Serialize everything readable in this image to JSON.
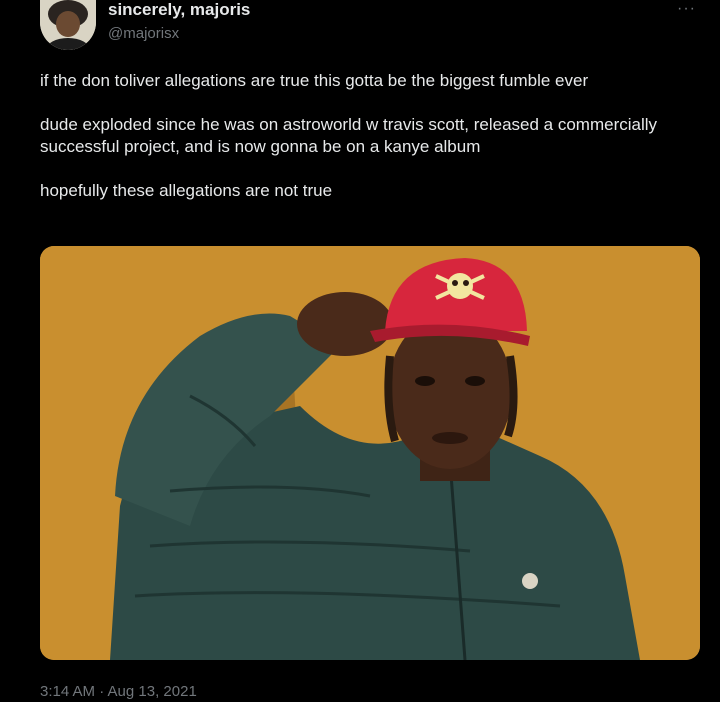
{
  "author": {
    "display_name": "sincerely, majoris",
    "handle": "@majorisx",
    "avatar_icon": "cartoon-avatar-icon"
  },
  "menu": {
    "more_label": "···"
  },
  "tweet": {
    "paragraphs": [
      "if the don toliver allegations are true this gotta be the biggest fumble ever",
      "dude exploded since he was on astroworld w travis scott, released a commercially successful project, and is now gonna be on a kanye album",
      "hopefully these allegations are not true"
    ],
    "timestamp": "3:14 AM · Aug 13, 2021"
  },
  "media": {
    "description_icon": "photo-person-red-cap",
    "background_color": "#c98f2f"
  },
  "colors": {
    "background": "#000000",
    "text": "#e7e9ea",
    "muted": "#71767b"
  }
}
